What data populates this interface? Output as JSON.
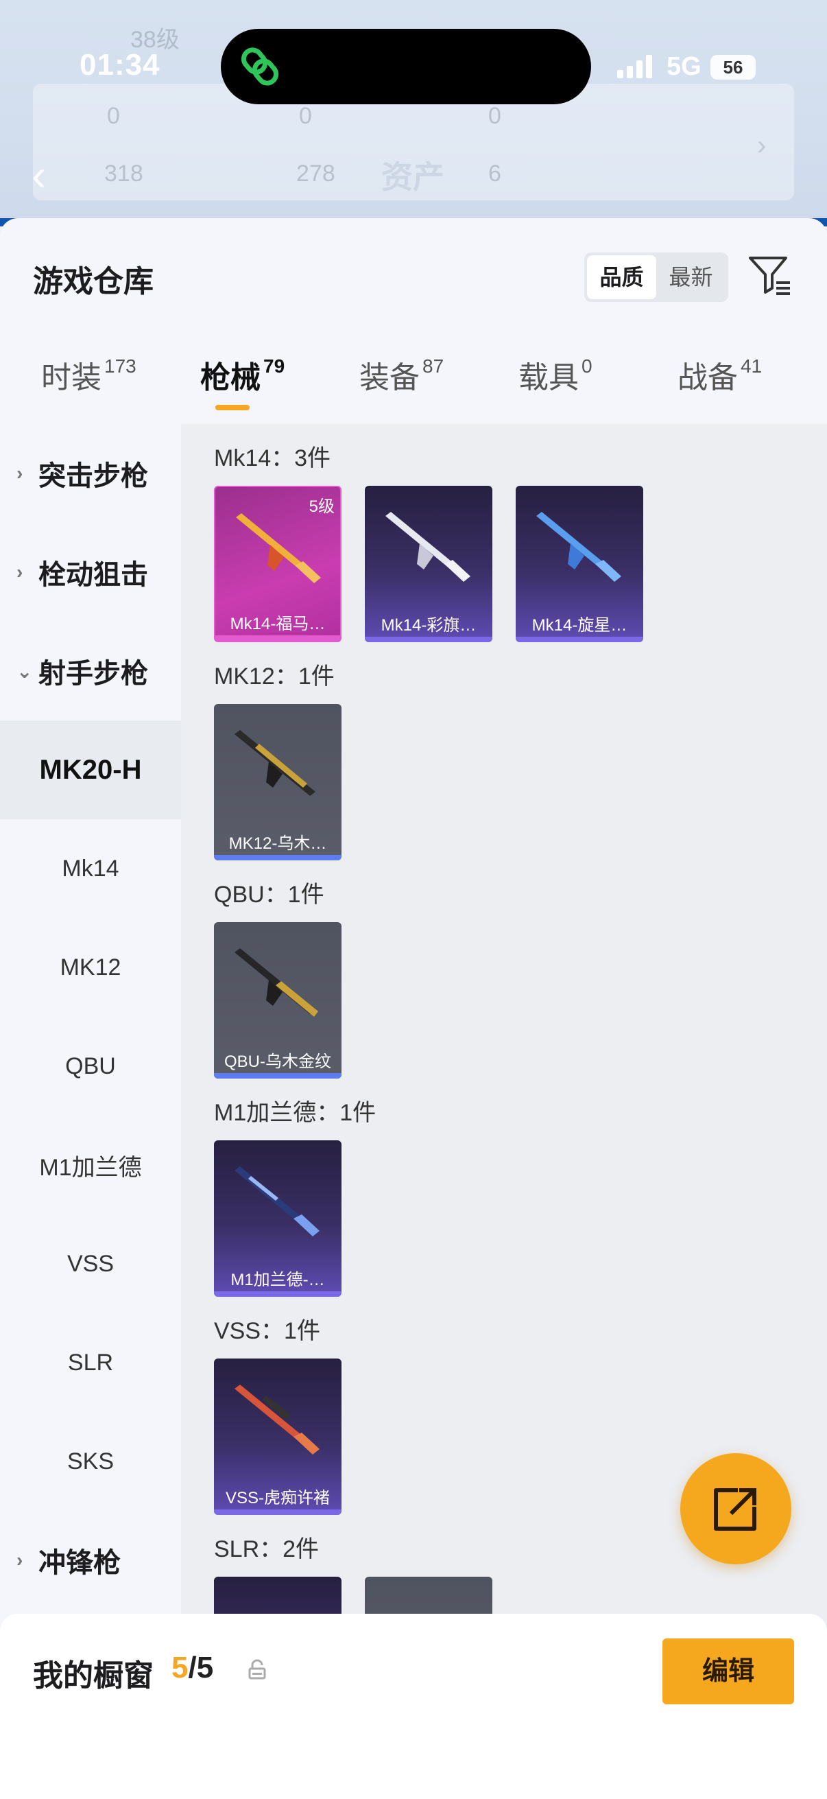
{
  "status": {
    "time": "01:34",
    "network": "5G",
    "battery": "56"
  },
  "background": {
    "level": "38级",
    "stats_row1": [
      "0",
      "0",
      "0"
    ],
    "stats_row2": [
      "318",
      "278",
      "6"
    ],
    "asset_title": "资产"
  },
  "header": {
    "title": "游戏仓库",
    "sort_options": [
      "品质",
      "最新"
    ],
    "active_sort": "品质"
  },
  "tabs": [
    {
      "label": "时装",
      "count": "173"
    },
    {
      "label": "枪械",
      "count": "79"
    },
    {
      "label": "装备",
      "count": "87"
    },
    {
      "label": "载具",
      "count": "0"
    },
    {
      "label": "战备",
      "count": "41"
    }
  ],
  "nav": {
    "groups": [
      "突击步枪",
      "栓动狙击",
      "射手步枪",
      "冲锋枪"
    ],
    "items": [
      "MK20-H",
      "Mk14",
      "MK12",
      "QBU",
      "M1加兰德",
      "VSS",
      "SLR",
      "SKS"
    ]
  },
  "content": {
    "groups": [
      {
        "title": "Mk14：3件",
        "cards": [
          {
            "name": "Mk14-福马…",
            "level": "5级"
          },
          {
            "name": "Mk14-彩旗…"
          },
          {
            "name": "Mk14-旋星…"
          }
        ]
      },
      {
        "title": "MK12：1件",
        "cards": [
          {
            "name": "MK12-乌木…"
          }
        ]
      },
      {
        "title": "QBU：1件",
        "cards": [
          {
            "name": "QBU-乌木金纹"
          }
        ]
      },
      {
        "title": "M1加兰德：1件",
        "cards": [
          {
            "name": "M1加兰德-…"
          }
        ]
      },
      {
        "title": "VSS：1件",
        "cards": [
          {
            "name": "VSS-虎痴许褚"
          }
        ]
      },
      {
        "title": "SLR：2件",
        "cards": []
      }
    ]
  },
  "bottom": {
    "label": "我的橱窗",
    "count_current": "5",
    "count_total": "/5",
    "edit_label": "编辑"
  },
  "colors": {
    "accent": "#f5a81e",
    "tab_underline": "#f5a623"
  }
}
